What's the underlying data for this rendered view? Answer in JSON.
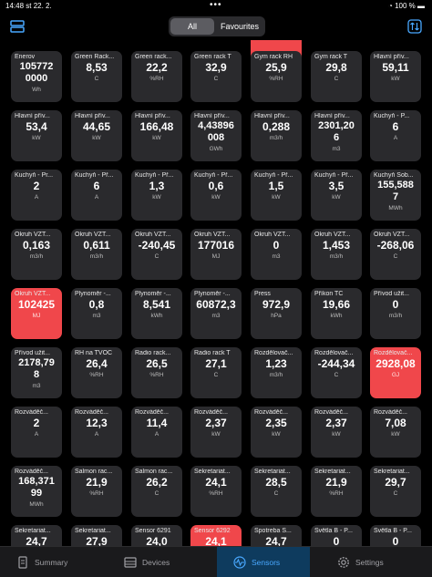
{
  "status": {
    "time": "14:48",
    "date": "st 22. 2.",
    "battery": "100 %"
  },
  "filter": {
    "all": "All",
    "favourites": "Favourites"
  },
  "tiles": [
    {
      "name": "",
      "value": "",
      "unit": "",
      "red": true
    },
    {
      "name": "Enerov",
      "value": "105772\n0000",
      "unit": "Wh",
      "red": false
    },
    {
      "name": "Green Rack...",
      "value": "8,53",
      "unit": "C",
      "red": false
    },
    {
      "name": "Green rack...",
      "value": "22,2",
      "unit": "%RH",
      "red": false
    },
    {
      "name": "Green rack T",
      "value": "32,9",
      "unit": "C",
      "red": false
    },
    {
      "name": "Gym rack RH",
      "value": "25,9",
      "unit": "%RH",
      "red": false
    },
    {
      "name": "Gym rack T",
      "value": "29,8",
      "unit": "C",
      "red": false
    },
    {
      "name": "Hlavní přív...",
      "value": "59,11",
      "unit": "kW",
      "red": false
    },
    {
      "name": "Hlavní přív...",
      "value": "53,4",
      "unit": "kW",
      "red": false
    },
    {
      "name": "Hlavní přív...",
      "value": "44,65",
      "unit": "kW",
      "red": false
    },
    {
      "name": "Hlavní přív...",
      "value": "166,48",
      "unit": "kW",
      "red": false
    },
    {
      "name": "Hlavní přív...",
      "value": "4,43896\n008",
      "unit": "GWh",
      "red": false
    },
    {
      "name": "Hlavní přív...",
      "value": "0,288",
      "unit": "m3/h",
      "red": false
    },
    {
      "name": "Hlavní přív...",
      "value": "2301,20\n6",
      "unit": "m3",
      "red": false
    },
    {
      "name": "Kuchyň - P...",
      "value": "6",
      "unit": "A",
      "red": false
    },
    {
      "name": "Kuchyň - Pr...",
      "value": "2",
      "unit": "A",
      "red": false
    },
    {
      "name": "Kuchyň - Př...",
      "value": "6",
      "unit": "A",
      "red": false
    },
    {
      "name": "Kuchyň - Př...",
      "value": "1,3",
      "unit": "kW",
      "red": false
    },
    {
      "name": "Kuchyň - Př...",
      "value": "0,6",
      "unit": "kW",
      "red": false
    },
    {
      "name": "Kuchyň - Př...",
      "value": "1,5",
      "unit": "kW",
      "red": false
    },
    {
      "name": "Kuchyň - Př...",
      "value": "3,5",
      "unit": "kW",
      "red": false
    },
    {
      "name": "Kuchyň Sob...",
      "value": "155,588\n7",
      "unit": "MWh",
      "red": false
    },
    {
      "name": "Okruh VZT...",
      "value": "0,163",
      "unit": "m3/h",
      "red": false
    },
    {
      "name": "Okruh VZT...",
      "value": "0,611",
      "unit": "m3/h",
      "red": false
    },
    {
      "name": "Okruh VZT...",
      "value": "-240,45",
      "unit": "C",
      "red": false
    },
    {
      "name": "Okruh VZT...",
      "value": "177016",
      "unit": "MJ",
      "red": false
    },
    {
      "name": "Okruh VZT...",
      "value": "0",
      "unit": "m3",
      "red": false
    },
    {
      "name": "Okruh VZT...",
      "value": "1,453",
      "unit": "m3/h",
      "red": false
    },
    {
      "name": "Okruh VZT...",
      "value": "-268,06",
      "unit": "C",
      "red": false
    },
    {
      "name": "Okruh VZT...",
      "value": "102425",
      "unit": "MJ",
      "red": true
    },
    {
      "name": "Plynoměr -...",
      "value": "0,8",
      "unit": "m3",
      "red": false
    },
    {
      "name": "Plynoměr -...",
      "value": "8,541",
      "unit": "kWh",
      "red": false
    },
    {
      "name": "Plynoměr -...",
      "value": "60872,3",
      "unit": "m3",
      "red": false
    },
    {
      "name": "Press",
      "value": "972,9",
      "unit": "hPa",
      "red": false
    },
    {
      "name": "Příkon TČ",
      "value": "19,66",
      "unit": "kWh",
      "red": false
    },
    {
      "name": "Přívod užit...",
      "value": "0",
      "unit": "m3/h",
      "red": false
    },
    {
      "name": "Přívod užit...",
      "value": "2178,79\n8",
      "unit": "m3",
      "red": false
    },
    {
      "name": "RH na TVOC",
      "value": "26,4",
      "unit": "%RH",
      "red": false
    },
    {
      "name": "Radio rack...",
      "value": "26,5",
      "unit": "%RH",
      "red": false
    },
    {
      "name": "Radio rack T",
      "value": "27,1",
      "unit": "C",
      "red": false
    },
    {
      "name": "Rozdělovač...",
      "value": "1,23",
      "unit": "m3/h",
      "red": false
    },
    {
      "name": "Rozdělovač...",
      "value": "-244,34",
      "unit": "C",
      "red": false
    },
    {
      "name": "Rozdělovač...",
      "value": "2928,08",
      "unit": "GJ",
      "red": true
    },
    {
      "name": "Rozváděč...",
      "value": "2",
      "unit": "A",
      "red": false
    },
    {
      "name": "Rozváděč...",
      "value": "12,3",
      "unit": "A",
      "red": false
    },
    {
      "name": "Rozváděč...",
      "value": "11,4",
      "unit": "A",
      "red": false
    },
    {
      "name": "Rozváděč...",
      "value": "2,37",
      "unit": "kW",
      "red": false
    },
    {
      "name": "Rozváděč...",
      "value": "2,35",
      "unit": "kW",
      "red": false
    },
    {
      "name": "Rozváděč...",
      "value": "2,37",
      "unit": "kW",
      "red": false
    },
    {
      "name": "Rozváděč...",
      "value": "7,08",
      "unit": "kW",
      "red": false
    },
    {
      "name": "Rozváděč...",
      "value": "168,371\n99",
      "unit": "MWh",
      "red": false
    },
    {
      "name": "Salmon rac...",
      "value": "21,9",
      "unit": "%RH",
      "red": false
    },
    {
      "name": "Salmon rac...",
      "value": "26,2",
      "unit": "C",
      "red": false
    },
    {
      "name": "Sekretariat...",
      "value": "24,1",
      "unit": "%RH",
      "red": false
    },
    {
      "name": "Sekretariat...",
      "value": "28,5",
      "unit": "C",
      "red": false
    },
    {
      "name": "Sekretariat...",
      "value": "21,9",
      "unit": "%RH",
      "red": false
    },
    {
      "name": "Sekretariat...",
      "value": "29,7",
      "unit": "C",
      "red": false
    },
    {
      "name": "Sekretariat...",
      "value": "24,7",
      "unit": "",
      "red": false
    },
    {
      "name": "Sekretariat...",
      "value": "27,9",
      "unit": "",
      "red": false
    },
    {
      "name": "Sensor 6291",
      "value": "24,0",
      "unit": "",
      "red": false
    },
    {
      "name": "Sensor 6292",
      "value": "24,1",
      "unit": "",
      "red": true
    },
    {
      "name": "Spotreba S...",
      "value": "24,7",
      "unit": "",
      "red": false
    },
    {
      "name": "Světla B - P...",
      "value": "0",
      "unit": "",
      "red": false
    },
    {
      "name": "Světla B - P...",
      "value": "0",
      "unit": "",
      "red": false
    }
  ],
  "tabs": [
    {
      "label": "Summary",
      "icon": "document-icon"
    },
    {
      "label": "Devices",
      "icon": "devices-icon"
    },
    {
      "label": "Sensors",
      "icon": "sensor-waveform-icon"
    },
    {
      "label": "Settings",
      "icon": "gear-icon"
    }
  ],
  "colors": {
    "accent": "#49a8ff",
    "alert": "#f0474b",
    "tile": "#2a2a2d"
  }
}
